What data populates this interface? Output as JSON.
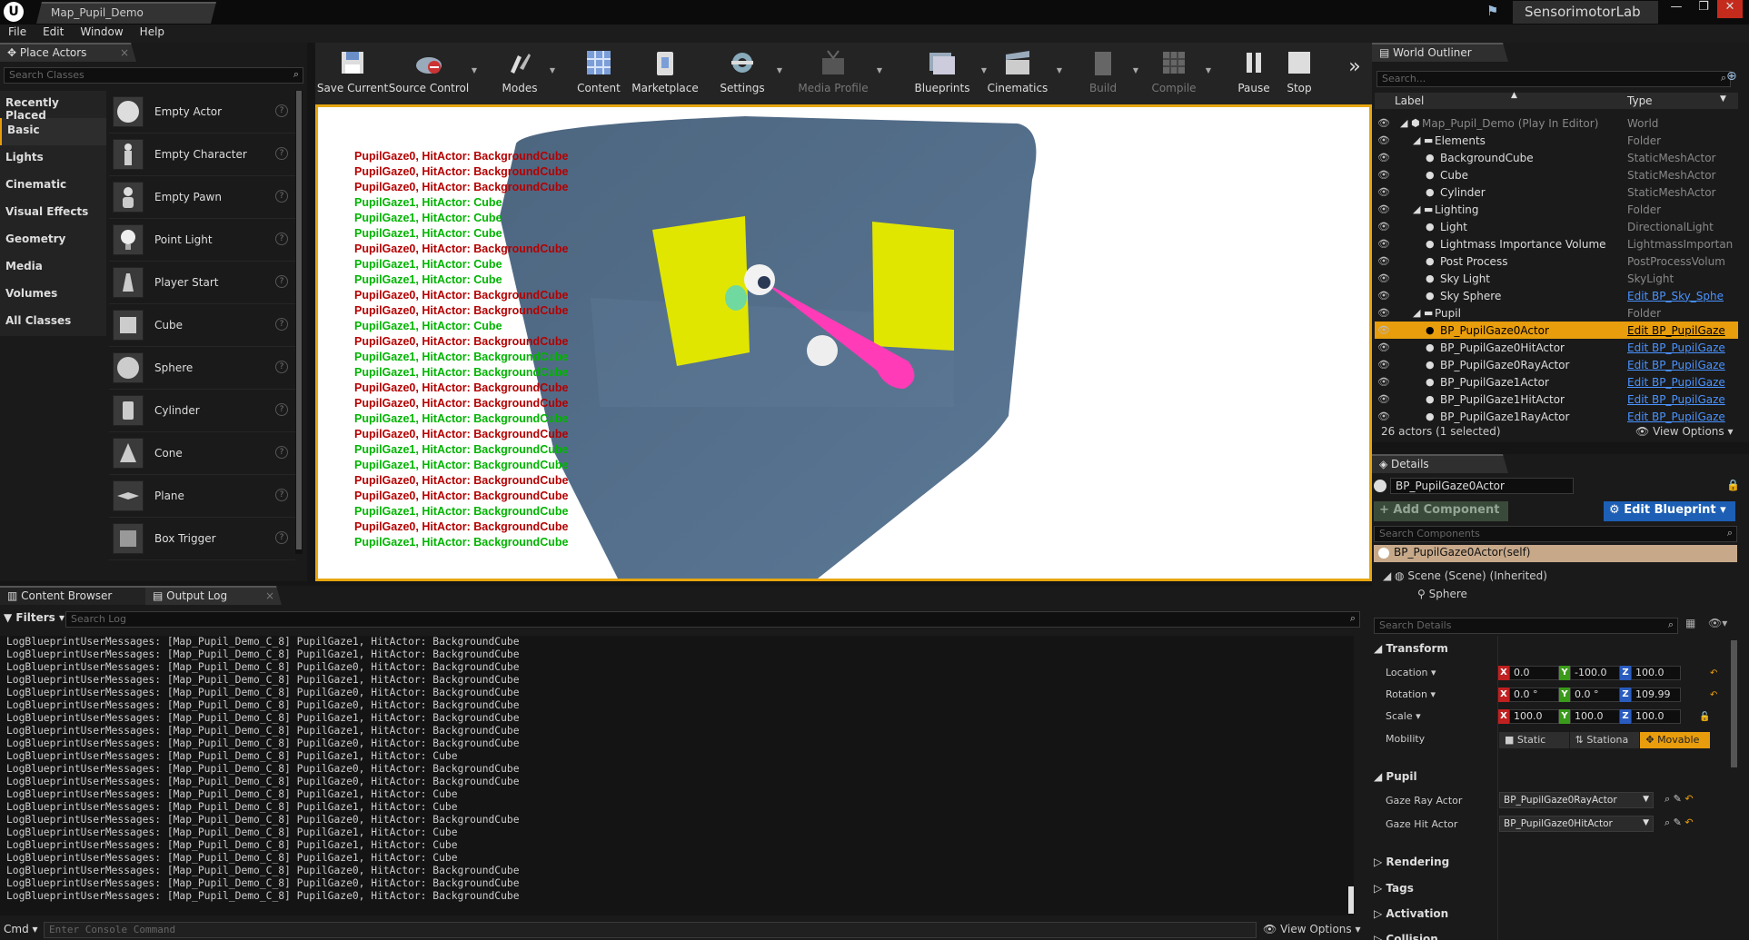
{
  "title_bar": {
    "doc_tab": "Map_Pupil_Demo",
    "project": "SensorimotorLab"
  },
  "menu": [
    "File",
    "Edit",
    "Window",
    "Help"
  ],
  "place_actors": {
    "tab": "Place Actors",
    "search_placeholder": "Search Classes",
    "categories": [
      "Recently Placed",
      "Basic",
      "Lights",
      "Cinematic",
      "Visual Effects",
      "Geometry",
      "Media",
      "Volumes",
      "All Classes"
    ],
    "selected_category": "Basic",
    "actors": [
      "Empty Actor",
      "Empty Character",
      "Empty Pawn",
      "Point Light",
      "Player Start",
      "Cube",
      "Sphere",
      "Cylinder",
      "Cone",
      "Plane",
      "Box Trigger"
    ]
  },
  "toolbar": [
    {
      "label": "Save Current",
      "icon": "save-icon"
    },
    {
      "label": "Source Control",
      "icon": "source-control-icon"
    },
    {
      "label": "Modes",
      "icon": "modes-icon"
    },
    {
      "label": "Content",
      "icon": "content-icon"
    },
    {
      "label": "Marketplace",
      "icon": "marketplace-icon"
    },
    {
      "label": "Settings",
      "icon": "settings-icon"
    },
    {
      "label": "Media Profile",
      "icon": "media-profile-icon"
    },
    {
      "label": "Blueprints",
      "icon": "blueprints-icon"
    },
    {
      "label": "Cinematics",
      "icon": "cinematics-icon"
    },
    {
      "label": "Build",
      "icon": "build-icon"
    },
    {
      "label": "Compile",
      "icon": "compile-icon"
    },
    {
      "label": "Pause",
      "icon": "pause-icon"
    },
    {
      "label": "Stop",
      "icon": "stop-icon"
    }
  ],
  "viewport_log": [
    {
      "t": "PupilGaze0, HitActor: BackgroundCube",
      "c": "red"
    },
    {
      "t": "PupilGaze0, HitActor: BackgroundCube",
      "c": "red"
    },
    {
      "t": "PupilGaze0, HitActor: BackgroundCube",
      "c": "red"
    },
    {
      "t": "PupilGaze1, HitActor: Cube",
      "c": "green"
    },
    {
      "t": "PupilGaze1, HitActor: Cube",
      "c": "green"
    },
    {
      "t": "PupilGaze1, HitActor: Cube",
      "c": "green"
    },
    {
      "t": "PupilGaze0, HitActor: BackgroundCube",
      "c": "red"
    },
    {
      "t": "PupilGaze1, HitActor: Cube",
      "c": "green"
    },
    {
      "t": "PupilGaze1, HitActor: Cube",
      "c": "green"
    },
    {
      "t": "PupilGaze0, HitActor: BackgroundCube",
      "c": "red"
    },
    {
      "t": "PupilGaze0, HitActor: BackgroundCube",
      "c": "red"
    },
    {
      "t": "PupilGaze1, HitActor: Cube",
      "c": "green"
    },
    {
      "t": "PupilGaze0, HitActor: BackgroundCube",
      "c": "red"
    },
    {
      "t": "PupilGaze1, HitActor: BackgroundCube",
      "c": "green"
    },
    {
      "t": "PupilGaze1, HitActor: BackgroundCube",
      "c": "green"
    },
    {
      "t": "PupilGaze0, HitActor: BackgroundCube",
      "c": "red"
    },
    {
      "t": "PupilGaze0, HitActor: BackgroundCube",
      "c": "red"
    },
    {
      "t": "PupilGaze1, HitActor: BackgroundCube",
      "c": "green"
    },
    {
      "t": "PupilGaze0, HitActor: BackgroundCube",
      "c": "red"
    },
    {
      "t": "PupilGaze1, HitActor: BackgroundCube",
      "c": "green"
    },
    {
      "t": "PupilGaze1, HitActor: BackgroundCube",
      "c": "green"
    },
    {
      "t": "PupilGaze0, HitActor: BackgroundCube",
      "c": "red"
    },
    {
      "t": "PupilGaze0, HitActor: BackgroundCube",
      "c": "red"
    },
    {
      "t": "PupilGaze1, HitActor: BackgroundCube",
      "c": "green"
    },
    {
      "t": "PupilGaze0, HitActor: BackgroundCube",
      "c": "red"
    },
    {
      "t": "PupilGaze1, HitActor: BackgroundCube",
      "c": "green"
    }
  ],
  "outliner": {
    "tab": "World Outliner",
    "search_placeholder": "Search...",
    "col_label": "Label",
    "col_type": "Type",
    "rows": [
      {
        "name": "Map_Pupil_Demo (Play In Editor)",
        "type": "World",
        "indent": 0,
        "dim": true
      },
      {
        "name": "Elements",
        "type": "Folder",
        "indent": 1
      },
      {
        "name": "BackgroundCube",
        "type": "StaticMeshActor",
        "indent": 2
      },
      {
        "name": "Cube",
        "type": "StaticMeshActor",
        "indent": 2
      },
      {
        "name": "Cylinder",
        "type": "StaticMeshActor",
        "indent": 2
      },
      {
        "name": "Lighting",
        "type": "Folder",
        "indent": 1
      },
      {
        "name": "Light",
        "type": "DirectionalLight",
        "indent": 2
      },
      {
        "name": "Lightmass Importance Volume",
        "type": "LightmassImportan",
        "indent": 2
      },
      {
        "name": "Post Process",
        "type": "PostProcessVolum",
        "indent": 2
      },
      {
        "name": "Sky Light",
        "type": "SkyLight",
        "indent": 2
      },
      {
        "name": "Sky Sphere",
        "type": "Edit BP_Sky_Sphe",
        "indent": 2,
        "link": true
      },
      {
        "name": "Pupil",
        "type": "Folder",
        "indent": 1
      },
      {
        "name": "BP_PupilGaze0Actor",
        "type": "Edit BP_PupilGaze",
        "indent": 2,
        "link": true,
        "sel": true
      },
      {
        "name": "BP_PupilGaze0HitActor",
        "type": "Edit BP_PupilGaze",
        "indent": 2,
        "link": true
      },
      {
        "name": "BP_PupilGaze0RayActor",
        "type": "Edit BP_PupilGaze",
        "indent": 2,
        "link": true
      },
      {
        "name": "BP_PupilGaze1Actor",
        "type": "Edit BP_PupilGaze",
        "indent": 2,
        "link": true
      },
      {
        "name": "BP_PupilGaze1HitActor",
        "type": "Edit BP_PupilGaze",
        "indent": 2,
        "link": true
      },
      {
        "name": "BP_PupilGaze1RayActor",
        "type": "Edit BP_PupilGaze",
        "indent": 2,
        "link": true
      }
    ],
    "status": "26 actors (1 selected)",
    "view_options": "View Options"
  },
  "details": {
    "tab": "Details",
    "actor_name": "BP_PupilGaze0Actor",
    "add_component": "+ Add Component",
    "edit_blueprint": "Edit Blueprint",
    "search_components": "Search Components",
    "self_row": "BP_PupilGaze0Actor(self)",
    "scene_row": "Scene (Scene) (Inherited)",
    "sphere_row": "Sphere",
    "search_details": "Search Details",
    "transform": "Transform",
    "location_label": "Location",
    "rotation_label": "Rotation",
    "scale_label": "Scale",
    "mobility_label": "Mobility",
    "location": [
      "0.0",
      "-100.0",
      "100.0"
    ],
    "rotation": [
      "0.0 °",
      "0.0 °",
      "109.99"
    ],
    "scale": [
      "100.0",
      "100.0",
      "100.0"
    ],
    "mobility": [
      "Static",
      "Stationa",
      "Movable"
    ],
    "pupil": "Pupil",
    "gaze_ray_label": "Gaze Ray Actor",
    "gaze_ray_value": "BP_PupilGaze0RayActor",
    "gaze_hit_label": "Gaze Hit Actor",
    "gaze_hit_value": "BP_PupilGaze0HitActor",
    "rendering": "Rendering",
    "tags": "Tags",
    "activation": "Activation",
    "collision": "Collision"
  },
  "bottom": {
    "tab_content_browser": "Content Browser",
    "tab_output_log": "Output Log",
    "filters": "Filters",
    "search_log": "Search Log",
    "cmd": "Cmd",
    "console_placeholder": "Enter Console Command",
    "view_options": "View Options"
  },
  "output_log": [
    "LogBlueprintUserMessages: [Map_Pupil_Demo_C_8] PupilGaze1, HitActor: BackgroundCube",
    "LogBlueprintUserMessages: [Map_Pupil_Demo_C_8] PupilGaze1, HitActor: BackgroundCube",
    "LogBlueprintUserMessages: [Map_Pupil_Demo_C_8] PupilGaze0, HitActor: BackgroundCube",
    "LogBlueprintUserMessages: [Map_Pupil_Demo_C_8] PupilGaze1, HitActor: BackgroundCube",
    "LogBlueprintUserMessages: [Map_Pupil_Demo_C_8] PupilGaze0, HitActor: BackgroundCube",
    "LogBlueprintUserMessages: [Map_Pupil_Demo_C_8] PupilGaze0, HitActor: BackgroundCube",
    "LogBlueprintUserMessages: [Map_Pupil_Demo_C_8] PupilGaze1, HitActor: BackgroundCube",
    "LogBlueprintUserMessages: [Map_Pupil_Demo_C_8] PupilGaze1, HitActor: BackgroundCube",
    "LogBlueprintUserMessages: [Map_Pupil_Demo_C_8] PupilGaze0, HitActor: BackgroundCube",
    "LogBlueprintUserMessages: [Map_Pupil_Demo_C_8] PupilGaze1, HitActor: Cube",
    "LogBlueprintUserMessages: [Map_Pupil_Demo_C_8] PupilGaze0, HitActor: BackgroundCube",
    "LogBlueprintUserMessages: [Map_Pupil_Demo_C_8] PupilGaze0, HitActor: BackgroundCube",
    "LogBlueprintUserMessages: [Map_Pupil_Demo_C_8] PupilGaze1, HitActor: Cube",
    "LogBlueprintUserMessages: [Map_Pupil_Demo_C_8] PupilGaze1, HitActor: Cube",
    "LogBlueprintUserMessages: [Map_Pupil_Demo_C_8] PupilGaze0, HitActor: BackgroundCube",
    "LogBlueprintUserMessages: [Map_Pupil_Demo_C_8] PupilGaze1, HitActor: Cube",
    "LogBlueprintUserMessages: [Map_Pupil_Demo_C_8] PupilGaze1, HitActor: Cube",
    "LogBlueprintUserMessages: [Map_Pupil_Demo_C_8] PupilGaze1, HitActor: Cube",
    "LogBlueprintUserMessages: [Map_Pupil_Demo_C_8] PupilGaze0, HitActor: BackgroundCube",
    "LogBlueprintUserMessages: [Map_Pupil_Demo_C_8] PupilGaze0, HitActor: BackgroundCube",
    "LogBlueprintUserMessages: [Map_Pupil_Demo_C_8] PupilGaze0, HitActor: BackgroundCube"
  ],
  "colors": {
    "accent": "#e89d0c",
    "red_msg": "#b40000",
    "green_msg": "#00b400",
    "link": "#4a93ff"
  }
}
